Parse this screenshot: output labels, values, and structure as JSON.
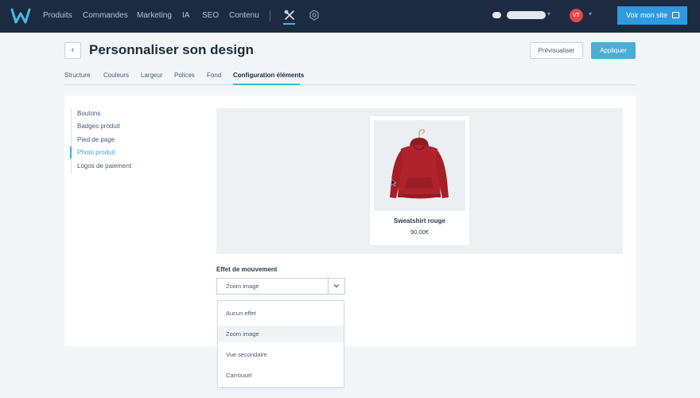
{
  "topbar": {
    "nav": [
      "Produits",
      "Commandes",
      "Marketing",
      "IA",
      "SEO",
      "Contenu"
    ],
    "avatar_initials": "VT",
    "site_button": "Voir mon site",
    "icons": [
      "logo-w",
      "design-tools-icon",
      "settings-gear-icon",
      "browser-window-icon"
    ]
  },
  "header": {
    "title": "Personnaliser son design",
    "back_label": "‹",
    "preview_button": "Prévisualiser",
    "apply_button": "Appliquer"
  },
  "tabs": [
    "Structure",
    "Couleurs",
    "Largeur",
    "Polices",
    "Fond",
    "Configuration éléments"
  ],
  "active_tab": "Configuration éléments",
  "sidebar": {
    "items": [
      "Boutons",
      "Badges produit",
      "Pied de page",
      "Photo produit",
      "Logos de paiement"
    ],
    "active": "Photo produit"
  },
  "product": {
    "name": "Sweatshirt rouge",
    "price": "90,00€"
  },
  "effect": {
    "label": "Effet de mouvement",
    "selected": "Zoom image",
    "options": [
      "Aucun effet",
      "Zoom image",
      "Vue secondaire",
      "Carrousel"
    ]
  },
  "colors": {
    "topbar": "#1c2b42",
    "accent": "#47b2d6",
    "site_button": "#2f9ae0",
    "apply_button": "#4aaed4",
    "avatar": "#e04848",
    "hoodie": "#b0232d"
  }
}
